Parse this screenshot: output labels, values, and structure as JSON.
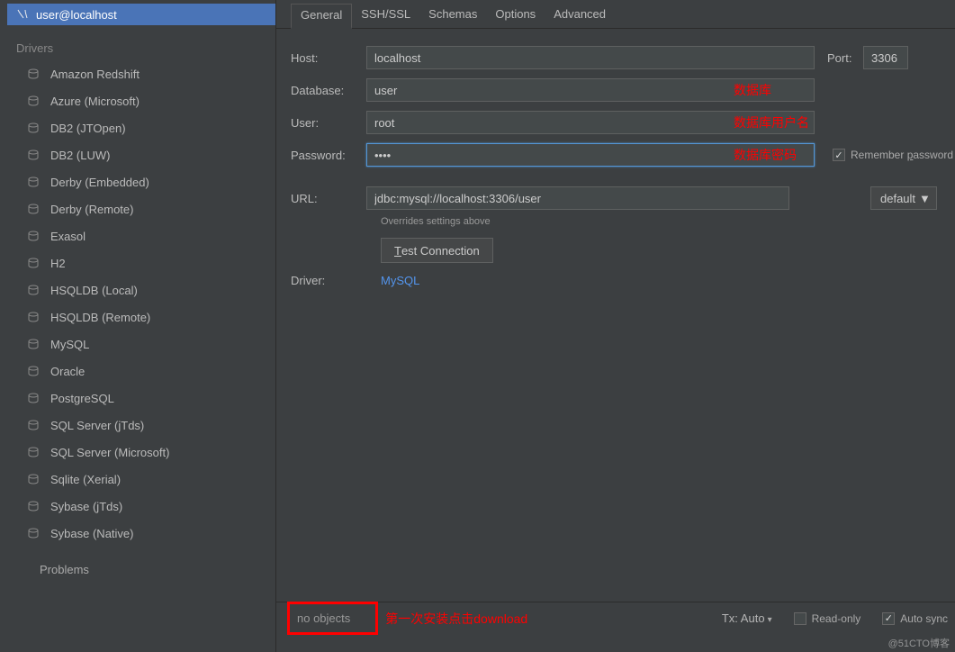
{
  "sidebar": {
    "selected_item": "user@localhost",
    "section_header": "Drivers",
    "drivers": [
      "Amazon Redshift",
      "Azure (Microsoft)",
      "DB2 (JTOpen)",
      "DB2 (LUW)",
      "Derby (Embedded)",
      "Derby (Remote)",
      "Exasol",
      "H2",
      "HSQLDB (Local)",
      "HSQLDB (Remote)",
      "MySQL",
      "Oracle",
      "PostgreSQL",
      "SQL Server (jTds)",
      "SQL Server (Microsoft)",
      "Sqlite (Xerial)",
      "Sybase (jTds)",
      "Sybase (Native)"
    ],
    "problems": "Problems"
  },
  "tabs": [
    "General",
    "SSH/SSL",
    "Schemas",
    "Options",
    "Advanced"
  ],
  "active_tab": "General",
  "form": {
    "host_label": "Host:",
    "host_value": "localhost",
    "port_label": "Port:",
    "port_value": "3306",
    "database_label": "Database:",
    "database_value": "user",
    "database_annotation": "数据库",
    "user_label": "User:",
    "user_value": "root",
    "user_annotation": "数据库用户名",
    "password_label": "Password:",
    "password_value": "••••",
    "password_annotation": "数据库密码",
    "remember_password_label": "Remember password",
    "url_label": "URL:",
    "url_value": "jdbc:mysql://localhost:3306/user",
    "overrides_text": "Overrides settings above",
    "url_dropdown": "default",
    "test_connection": "Test Connection",
    "driver_label": "Driver:",
    "driver_value": "MySQL"
  },
  "bottom": {
    "no_objects": "no objects",
    "install_note": "第一次安装点击download",
    "tx_label": "Tx: Auto",
    "readonly_label": "Read-only",
    "autosync_label": "Auto sync"
  },
  "watermark": "@51CTO博客"
}
